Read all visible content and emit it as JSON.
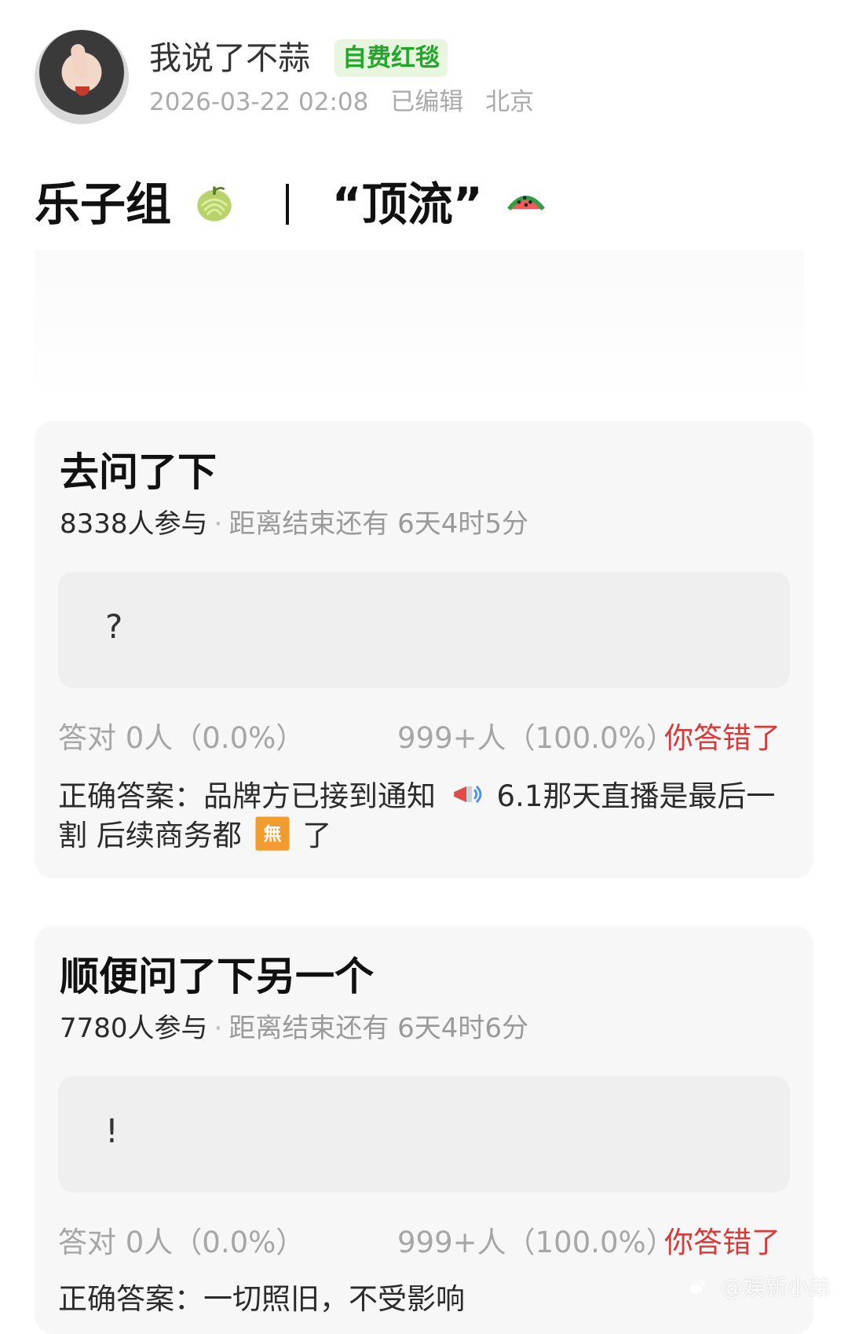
{
  "header": {
    "username": "我说了不蒜",
    "badge": "自费红毯",
    "timestamp": "2026-03-22 02:08",
    "edited": "已编辑",
    "location": "北京"
  },
  "post": {
    "title_left": "乐子组",
    "title_right": "“顶流”"
  },
  "polls": [
    {
      "title": "去问了下",
      "participants": "8338人参与",
      "time_left": "距离结束还有 6天4时5分",
      "option": "?",
      "correct_label": "答对",
      "correct_count": "0人（0.0%）",
      "wrong_count": "999+人（100.0%）",
      "result_status": "你答错了",
      "answer_label": "正确答案：",
      "answer_text_1": "品牌方已接到通知",
      "answer_text_2": "6.1那天直播是最后一割 后续商务都",
      "answer_text_3": "了"
    },
    {
      "title": "顺便问了下另一个",
      "participants": "7780人参与",
      "time_left": "距离结束还有 6天4时6分",
      "option": "!",
      "correct_label": "答对",
      "correct_count": "0人（0.0%）",
      "wrong_count": "999+人（100.0%）",
      "result_status": "你答错了",
      "answer_label": "正确答案：",
      "answer_text_1": "一切照旧，不受影响"
    }
  ],
  "watermark": "@娱新小弟",
  "colors": {
    "badge_bg": "#e8f6df",
    "badge_text": "#22a829",
    "error_red": "#d63a3a",
    "card_bg": "#f7f7f7",
    "option_bg": "#efefef"
  },
  "icons": {
    "title_left_emoji": "melon-icon",
    "title_right_emoji": "watermelon-icon",
    "notice_icon": "megaphone-icon",
    "no_icon": "no-icon",
    "weibo_icon": "weibo-icon"
  }
}
